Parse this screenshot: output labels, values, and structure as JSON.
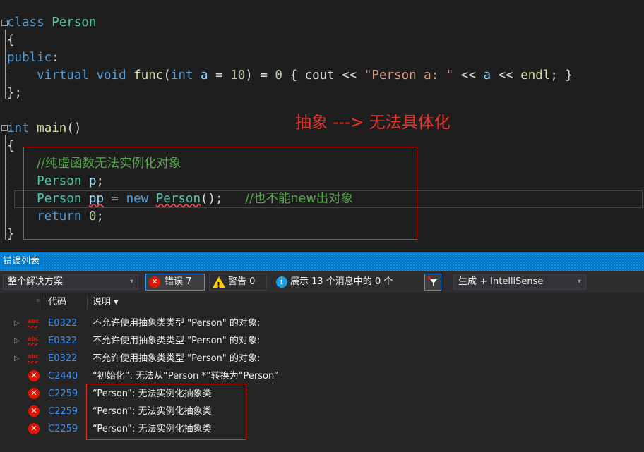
{
  "editor": {
    "annotation": "抽象 ---> 无法具体化",
    "lines": {
      "l1_class": "class",
      "l1_name": "Person",
      "l2": "{",
      "l3_public": "public",
      "l4_virtual": "virtual",
      "l4_void": "void",
      "l4_func": "func",
      "l4_int": "int",
      "l4_a": "a",
      "l4_ten": "10",
      "l4_zero": "0",
      "l4_cout": "cout",
      "l4_str": "\"Person a: \"",
      "l4_a2": "a",
      "l4_endl": "endl",
      "l5": "};",
      "l6_int": "int",
      "l6_main": "main",
      "l7": "{",
      "l8_comment": "//纯虚函数无法实例化对象",
      "l9_type": "Person",
      "l9_var": "p",
      "l10_type": "Person",
      "l10_var": "pp",
      "l10_new": "new",
      "l10_ctor": "Person",
      "l10_comment": "//也不能new出对象",
      "l11_return": "return",
      "l11_zero": "0",
      "l12": "}"
    }
  },
  "error_list": {
    "title": "错误列表",
    "scope": "整个解决方案",
    "errors_label": "错误 7",
    "warnings_label": "警告 0",
    "messages_label": "展示 13 个消息中的 0 个",
    "build_filter": "生成 + IntelliSense",
    "col_code": "代码",
    "col_desc": "说明 ▾",
    "rows": [
      {
        "code": "E0322",
        "desc": "不允许使用抽象类类型 \"Person\" 的对象:"
      },
      {
        "code": "E0322",
        "desc": "不允许使用抽象类类型 \"Person\" 的对象:"
      },
      {
        "code": "E0322",
        "desc": "不允许使用抽象类类型 \"Person\" 的对象:"
      },
      {
        "code": "C2440",
        "desc": "“初始化”: 无法从“Person *”转换为“Person”"
      },
      {
        "code": "C2259",
        "desc": "“Person”: 无法实例化抽象类"
      },
      {
        "code": "C2259",
        "desc": "“Person”: 无法实例化抽象类"
      },
      {
        "code": "C2259",
        "desc": "“Person”: 无法实例化抽象类"
      }
    ]
  },
  "colors": {
    "keyword": "#569cd6",
    "type": "#4ec9b0",
    "comment": "#57a64a",
    "annotation": "#e8352b",
    "accent": "#007acc"
  }
}
